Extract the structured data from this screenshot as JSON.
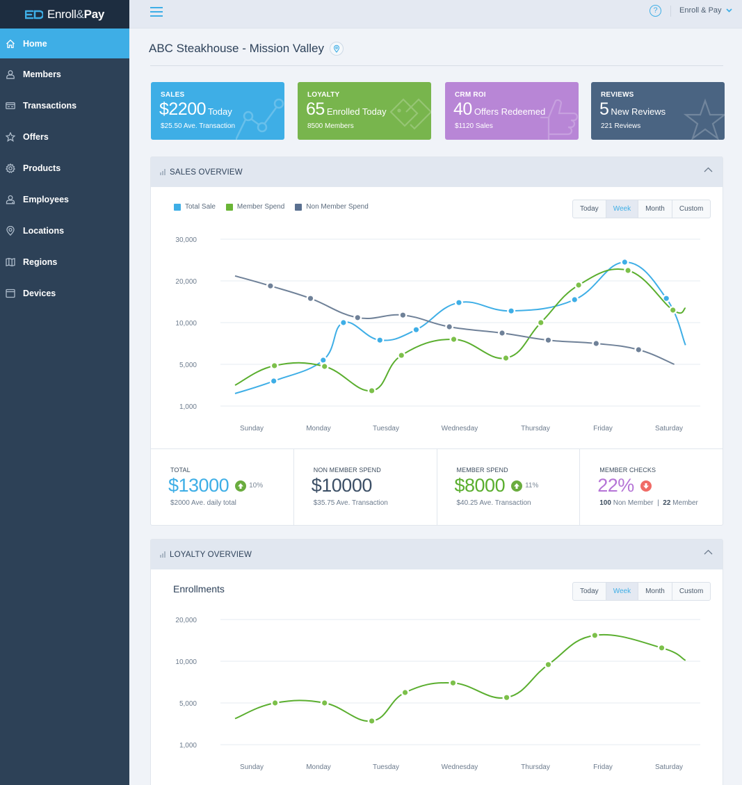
{
  "brand": {
    "name_light": "Enroll",
    "amp": "&",
    "name_bold": "Pay"
  },
  "sidebar": {
    "items": [
      {
        "label": "Home",
        "icon": "home-icon",
        "active": true
      },
      {
        "label": "Members",
        "icon": "user-icon",
        "active": false
      },
      {
        "label": "Transactions",
        "icon": "card-icon",
        "active": false
      },
      {
        "label": "Offers",
        "icon": "star-icon",
        "active": false
      },
      {
        "label": "Products",
        "icon": "gear-icon",
        "active": false
      },
      {
        "label": "Employees",
        "icon": "employee-icon",
        "active": false
      },
      {
        "label": "Locations",
        "icon": "location-pin-icon",
        "active": false
      },
      {
        "label": "Regions",
        "icon": "map-icon",
        "active": false
      },
      {
        "label": "Devices",
        "icon": "device-icon",
        "active": false
      }
    ]
  },
  "topbar": {
    "help_label": "?",
    "account_label": "Enroll & Pay"
  },
  "page": {
    "title": "ABC Steakhouse - Mission Valley"
  },
  "cards": {
    "sales": {
      "label": "SALES",
      "value": "$2200",
      "value_suffix": "Today",
      "sub": "$25.50 Ave. Transaction"
    },
    "loyalty": {
      "label": "LOYALTY",
      "value": "65",
      "value_suffix": "Enrolled Today",
      "sub": "8500 Members"
    },
    "crm": {
      "label": "CRM ROI",
      "value": "40",
      "value_suffix": "Offers Redeemed",
      "sub": "$1120 Sales"
    },
    "reviews": {
      "label": "REVIEWS",
      "value": "5",
      "value_suffix": "New Reviews",
      "sub": "221 Reviews"
    }
  },
  "sales_overview": {
    "title": "SALES OVERVIEW",
    "range_buttons": [
      "Today",
      "Week",
      "Month",
      "Custom"
    ],
    "selected_range": "Week",
    "stats": [
      {
        "label": "TOTAL",
        "value": "$13000",
        "trend": "up",
        "pct": "10%",
        "sub": "$2000 Ave. daily total",
        "color": "#3eaee6"
      },
      {
        "label": "NON MEMBER SPEND",
        "value": "$10000",
        "trend": "",
        "pct": "",
        "sub": "$35.75 Ave. Transaction",
        "color": "#3c4f66"
      },
      {
        "label": "MEMBER SPEND",
        "value": "$8000",
        "trend": "up",
        "pct": "11%",
        "sub": "$40.25 Ave. Transaction",
        "color": "#5aae2e"
      },
      {
        "label": "MEMBER CHECKS",
        "value": "22%",
        "trend": "down",
        "pct": "",
        "sub_nonmember_count": "100",
        "sub_nonmember_label": "Non Member",
        "sub_sep": "|",
        "sub_member_count": "22",
        "sub_member_label": "Member",
        "color": "#b574d6"
      }
    ]
  },
  "loyalty_overview": {
    "title": "LOYALTY OVERVIEW",
    "chart_title": "Enrollments",
    "range_buttons": [
      "Today",
      "Week",
      "Month",
      "Custom"
    ],
    "selected_range": "Week"
  },
  "colors": {
    "accent": "#3eaee6",
    "total_sale": "#3eaee6",
    "member_spend": "#5aae2e",
    "member_spend_marker": "#7cc04a",
    "non_member": "#6f8198",
    "trend_up": "#6aac3e",
    "trend_down": "#f06b66"
  },
  "chart_data": [
    {
      "type": "line",
      "title": "Sales Overview",
      "categories": [
        "Sunday",
        "Monday",
        "Tuesday",
        "Wednesday",
        "Thursday",
        "Friday",
        "Saturday"
      ],
      "yticks": [
        1000,
        5000,
        10000,
        20000,
        30000
      ],
      "ytick_labels": [
        "1,000",
        "5,000",
        "10,000",
        "20,000",
        "30,000"
      ],
      "ylim": [
        1000,
        30000
      ],
      "grid": true,
      "legend": "top-left",
      "series": [
        {
          "name": "Total Sale",
          "color": "#3eaee6",
          "start": {
            "x": -0.25,
            "y": 2200
          },
          "end": {
            "x": 6.25,
            "y": 7300
          },
          "points": [
            {
              "x": 0.33,
              "y": 3400
            },
            {
              "x": 1.07,
              "y": 5500
            },
            {
              "x": 1.37,
              "y": 10000
            },
            {
              "x": 1.91,
              "y": 7900
            },
            {
              "x": 2.41,
              "y": 9150
            },
            {
              "x": 2.99,
              "y": 14800
            },
            {
              "x": 3.68,
              "y": 12800
            },
            {
              "x": 4.58,
              "y": 15500
            },
            {
              "x": 5.33,
              "y": 24500
            },
            {
              "x": 5.96,
              "y": 15800
            }
          ]
        },
        {
          "name": "Member Spend",
          "color": "#5aae2e",
          "start": {
            "x": -0.25,
            "y": 3000
          },
          "end": {
            "x": 6.25,
            "y": 13500
          },
          "points": [
            {
              "x": 0.34,
              "y": 4870
            },
            {
              "x": 1.09,
              "y": 4800
            },
            {
              "x": 1.79,
              "y": 2470
            },
            {
              "x": 2.21,
              "y": 6080
            },
            {
              "x": 2.92,
              "y": 8000
            },
            {
              "x": 3.61,
              "y": 5750
            },
            {
              "x": 4.08,
              "y": 10000
            },
            {
              "x": 4.64,
              "y": 19000
            },
            {
              "x": 5.38,
              "y": 22500
            },
            {
              "x": 6.06,
              "y": 13000
            }
          ]
        },
        {
          "name": "Non Member Spend",
          "color": "#6f8198",
          "start": {
            "x": -0.25,
            "y": 21200
          },
          "end": {
            "x": 6.08,
            "y": 5000
          },
          "points": [
            {
              "x": 0.28,
              "y": 18800
            },
            {
              "x": 0.88,
              "y": 15800
            },
            {
              "x": 1.58,
              "y": 11200
            },
            {
              "x": 2.23,
              "y": 11800
            },
            {
              "x": 2.86,
              "y": 9500
            },
            {
              "x": 3.56,
              "y": 8750
            },
            {
              "x": 4.19,
              "y": 7900
            },
            {
              "x": 4.9,
              "y": 7500
            },
            {
              "x": 5.54,
              "y": 6750
            }
          ]
        }
      ]
    },
    {
      "type": "line",
      "title": "Enrollments",
      "categories": [
        "Sunday",
        "Monday",
        "Tuesday",
        "Wednesday",
        "Thursday",
        "Friday",
        "Saturday"
      ],
      "yticks": [
        1000,
        5000,
        10000,
        20000
      ],
      "ytick_labels": [
        "1,000",
        "5,000",
        "10,000",
        "20,000"
      ],
      "ylim": [
        1000,
        20000
      ],
      "grid": true,
      "series": [
        {
          "name": "Enrollments",
          "color": "#5aae2e",
          "start": {
            "x": -0.25,
            "y": 3500
          },
          "end": {
            "x": 6.25,
            "y": 10200
          },
          "points": [
            {
              "x": 0.35,
              "y": 5000
            },
            {
              "x": 1.09,
              "y": 5000
            },
            {
              "x": 1.79,
              "y": 3270
            },
            {
              "x": 2.26,
              "y": 6250
            },
            {
              "x": 2.91,
              "y": 7400
            },
            {
              "x": 3.62,
              "y": 5650
            },
            {
              "x": 4.19,
              "y": 9600
            },
            {
              "x": 4.88,
              "y": 16200
            },
            {
              "x": 5.89,
              "y": 13200
            }
          ]
        }
      ]
    }
  ]
}
